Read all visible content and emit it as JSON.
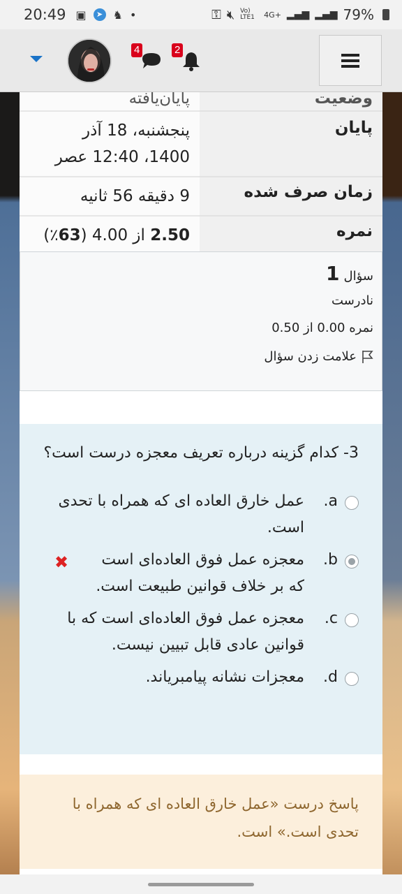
{
  "status_bar": {
    "time": "20:49",
    "battery": "79%",
    "network": "4G+",
    "volte": "Vo) LTE1"
  },
  "header": {
    "messages_count": "4",
    "notifications_count": "2"
  },
  "summary": {
    "state_label": "وضعیت",
    "state_value": "پایان‌یافته",
    "end_label": "پایان",
    "end_value_line1": "پنجشنبه، 18 آذر",
    "end_value_line2": "1400، 12:40 عصر",
    "time_taken_label": "زمان صرف شده",
    "time_taken_value": "9 دقیقه 56 ثانیه",
    "grade_label": "نمره",
    "grade_value_bold": "2.50",
    "grade_value_rest": " از 4.00 (",
    "grade_percent": "63",
    "grade_percent_suffix": "٪)"
  },
  "question_info": {
    "label": "سؤال",
    "number": "1",
    "state": "نادرست",
    "mark": "نمره 0.00 از 0.50",
    "flag_label": "علامت زدن سؤال"
  },
  "question": {
    "text": "3- کدام گزینه درباره تعریف معجزه درست است؟",
    "options": [
      {
        "letter": "a.",
        "text": "عمل خارق العاده ای که همراه با تحدی است.",
        "checked": false
      },
      {
        "letter": "b.",
        "text": "معجزه عمل فوق العاده‌ای است که بر خلاف قوانین طبیعت است.",
        "checked": true
      },
      {
        "letter": "c.",
        "text": "معجزه عمل فوق العاده‌ای است که با قوانین عادی قابل تبیین نیست.",
        "checked": false
      },
      {
        "letter": "d.",
        "text": "معجزات نشانه پیامبریاند.",
        "checked": false
      }
    ]
  },
  "feedback": {
    "text": "پاسخ درست «عمل خارق العاده ای که همراه با تحدی است.» است."
  },
  "colors": {
    "header_bg": "#e9e9e9",
    "question_bg": "#e5f1f6",
    "feedback_bg": "#fcefdc",
    "feedback_text": "#8e662e",
    "badge": "#d9001b",
    "incorrect_mark": "#dd2222"
  }
}
